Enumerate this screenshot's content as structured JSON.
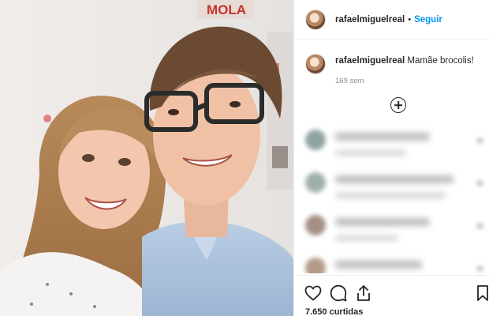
{
  "post": {
    "author": "rafaelmiguelreal",
    "follow_label": "Seguir",
    "separator": "•",
    "caption_user": "rafaelmiguelreal",
    "caption_text": "Mamãe brocolis!",
    "time_ago": "169 sem",
    "likes": "7.650 curtidas"
  },
  "photo": {
    "poster_text": "MOLA"
  },
  "comments": [
    {
      "avatar_color": "#8fa3a2",
      "w1": 120,
      "w2": 90
    },
    {
      "avatar_color": "#9fb0aa",
      "w1": 150,
      "w2": 140
    },
    {
      "avatar_color": "#a58f85",
      "w1": 120,
      "w2": 80
    },
    {
      "avatar_color": "#b59a8a",
      "w1": 110,
      "w2": 100
    }
  ],
  "icons": {
    "like": "heart-icon",
    "comment": "comment-icon",
    "share": "share-icon",
    "save": "bookmark-icon",
    "more": "plus-circle-icon"
  },
  "colors": {
    "link": "#0095f6",
    "muted": "#8e8e8e",
    "text": "#262626"
  }
}
